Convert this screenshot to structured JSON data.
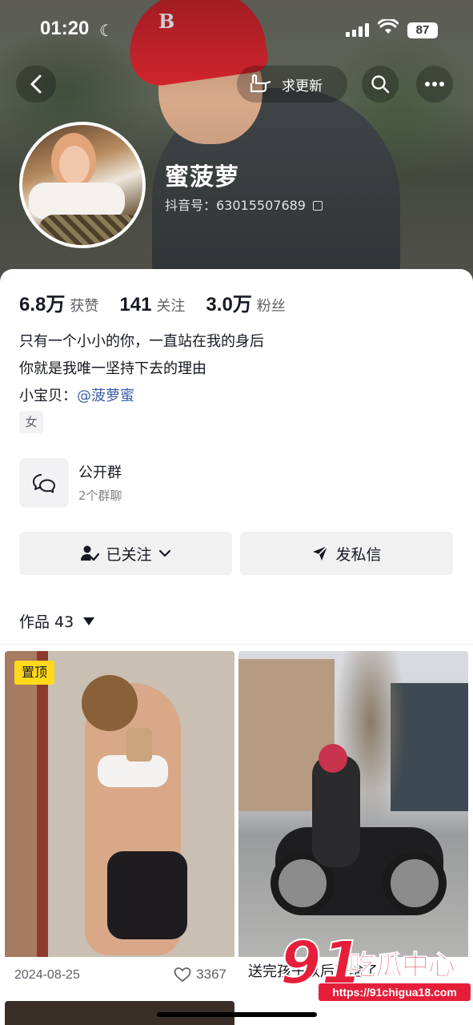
{
  "status_bar": {
    "time": "01:20",
    "battery": "87"
  },
  "header": {
    "update_label": "求更新"
  },
  "profile": {
    "name": "蜜菠萝",
    "douyin_id": "抖音号：63015507689"
  },
  "stats": [
    {
      "value": "6.8万",
      "label": "获赞"
    },
    {
      "value": "141",
      "label": "关注"
    },
    {
      "value": "3.0万",
      "label": "粉丝"
    }
  ],
  "bio": {
    "line1": "只有一个小小的你，一直站在我的身后",
    "line2": "你就是我唯一坚持下去的理由",
    "line3_prefix": "小宝贝：",
    "line3_mention": "@菠萝蜜"
  },
  "tags": {
    "gender": "女"
  },
  "group": {
    "title": "公开群",
    "subtitle": "2个群聊"
  },
  "actions": {
    "follow_label": "已关注",
    "message_label": "发私信"
  },
  "works": {
    "label": "作品 43"
  },
  "videos": [
    {
      "badge": "置顶",
      "date": "2024-08-25",
      "likes": "3367"
    },
    {
      "caption": "送完孩子以后干啥了"
    }
  ],
  "watermark": {
    "number": "91",
    "text": "吃瓜中心",
    "url": "https://91chigua18.com"
  }
}
